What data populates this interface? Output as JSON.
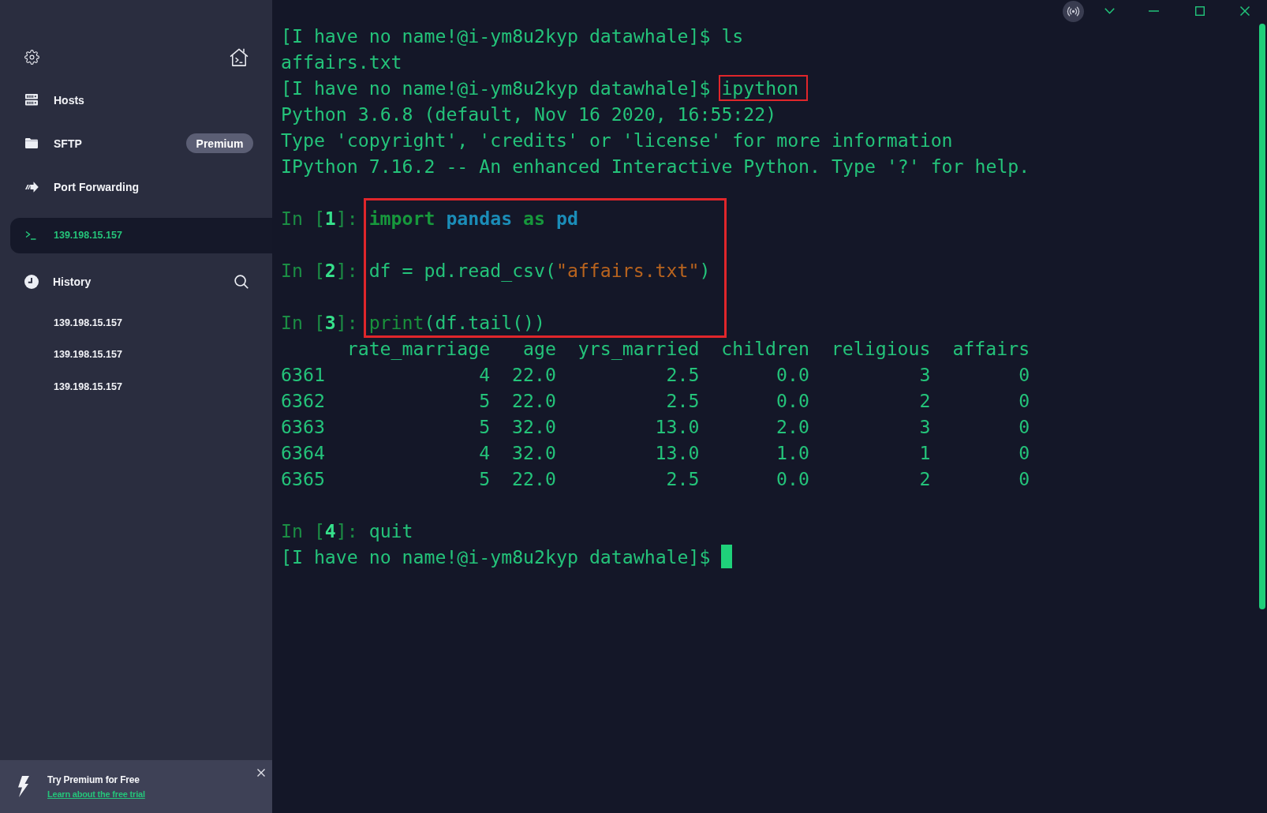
{
  "sidebar": {
    "nav_items": [
      {
        "kind": "hosts",
        "label": "Hosts",
        "selected": false
      },
      {
        "kind": "sftp",
        "label": "SFTP",
        "badge": "Premium",
        "selected": false
      },
      {
        "kind": "forwarding",
        "label": "Port Forwarding",
        "selected": false
      }
    ],
    "sessions": [
      {
        "label": "139.198.15.157",
        "selected": true
      }
    ],
    "history": {
      "title": "History",
      "items": [
        {
          "label": "139.198.15.157",
          "selected": false
        },
        {
          "label": "139.198.15.157",
          "selected": false
        },
        {
          "label": "139.198.15.157",
          "selected": false
        }
      ]
    },
    "promo": {
      "title": "Try Premium for Free",
      "link": "Learn about the free trial"
    }
  },
  "terminal": {
    "lines": [
      {
        "kind": "prompt",
        "prompt": "[I have no name!@i-ym8u2kyp datawhale]$",
        "command": "ls",
        "highlighted": false
      },
      {
        "kind": "output",
        "text": "affairs.txt"
      },
      {
        "kind": "prompt",
        "prompt": "[I have no name!@i-ym8u2kyp datawhale]$",
        "command": "ipython",
        "highlighted": true
      },
      {
        "kind": "output",
        "text": "Python 3.6.8 (default, Nov 16 2020, 16:55:22)"
      },
      {
        "kind": "output",
        "text": "Type 'copyright', 'credits' or 'license' for more information"
      },
      {
        "kind": "output",
        "text": "IPython 7.16.2 -- An enhanced Interactive Python. Type '?' for help."
      }
    ],
    "cells": {
      "highlighted": true,
      "items": [
        {
          "prompt": "In [**1**]:",
          "words": [
            {
              "tokens": [
                {
                  "kind": "keyword",
                  "text": "import"
                }
              ]
            },
            {
              "tokens": [
                {
                  "kind": "module",
                  "text": "pandas"
                }
              ]
            },
            {
              "tokens": [
                {
                  "kind": "keyword",
                  "text": "as"
                }
              ]
            },
            {
              "tokens": [
                {
                  "kind": "module",
                  "text": "pd"
                }
              ]
            }
          ]
        },
        {
          "prompt": "In [**2**]:",
          "words": [
            {
              "tokens": [
                {
                  "kind": "plain",
                  "text": "df"
                }
              ]
            },
            {
              "tokens": [
                {
                  "kind": "plain",
                  "text": "="
                }
              ]
            },
            {
              "tokens": [
                {
                  "kind": "plain",
                  "text": "pd.read_csv("
                },
                {
                  "kind": "string",
                  "text": "\"affairs.txt\""
                },
                {
                  "kind": "plain",
                  "text": ")"
                }
              ]
            }
          ]
        },
        {
          "prompt": "In [**3**]:",
          "words": [
            {
              "tokens": [
                {
                  "kind": "builtin",
                  "text": "print"
                },
                {
                  "kind": "plain",
                  "text": "(df.tail())"
                }
              ]
            }
          ]
        }
      ]
    },
    "dataframe": {
      "columns": [
        "rate_marriage",
        "age",
        "yrs_married",
        "children",
        "religious",
        "affairs"
      ],
      "rows": [
        {
          "index": "6361",
          "values": [
            "4",
            "22.0",
            "2.5",
            "0.0",
            "3",
            "0"
          ]
        },
        {
          "index": "6362",
          "values": [
            "5",
            "22.0",
            "2.5",
            "0.0",
            "2",
            "0"
          ]
        },
        {
          "index": "6363",
          "values": [
            "5",
            "32.0",
            "13.0",
            "2.0",
            "3",
            "0"
          ]
        },
        {
          "index": "6364",
          "values": [
            "4",
            "32.0",
            "13.0",
            "1.0",
            "1",
            "0"
          ]
        },
        {
          "index": "6365",
          "values": [
            "5",
            "22.0",
            "2.5",
            "0.0",
            "2",
            "0"
          ]
        }
      ]
    },
    "later_cells": [
      {
        "prompt": "In [**4**]:",
        "words": [
          {
            "tokens": [
              {
                "kind": "plain",
                "text": "quit"
              }
            ]
          }
        ]
      }
    ],
    "final_prompt": {
      "prompt": "[I have no name!@i-ym8u2kyp datawhale]$",
      "cursor": true
    }
  }
}
